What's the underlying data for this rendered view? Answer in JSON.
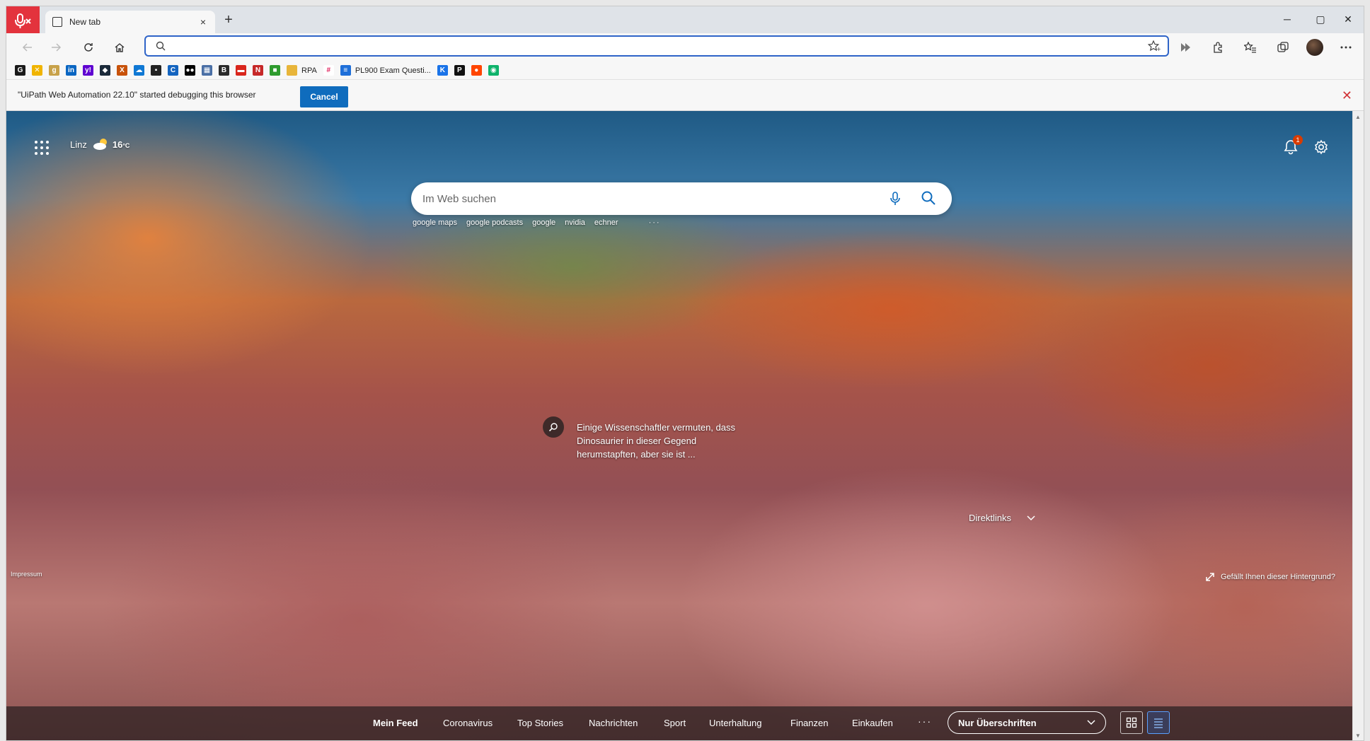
{
  "window": {
    "tab_title": "New tab",
    "tab_close": "×",
    "new_tab": "+",
    "controls": {
      "minimize": "─",
      "maximize": "▢",
      "close": "✕"
    }
  },
  "favorites": [
    {
      "icon": "g-doc-icon",
      "color": "#1a1a1a",
      "glyph": "G",
      "label": ""
    },
    {
      "icon": "x-icon",
      "color": "#f0b400",
      "glyph": "✕",
      "label": ""
    },
    {
      "icon": "g-icon",
      "color": "#c8a24a",
      "glyph": "g",
      "label": ""
    },
    {
      "icon": "linkedin-icon",
      "color": "#0a66c2",
      "glyph": "in",
      "label": ""
    },
    {
      "icon": "yahoo-icon",
      "color": "#5f01d1",
      "glyph": "y!",
      "label": ""
    },
    {
      "icon": "cube-icon",
      "color": "#1b2a3a",
      "glyph": "◆",
      "label": ""
    },
    {
      "icon": "xing-icon",
      "color": "#c8520a",
      "glyph": "X",
      "label": ""
    },
    {
      "icon": "onedrive-icon",
      "color": "#0f78d4",
      "glyph": "☁",
      "label": ""
    },
    {
      "icon": "dash-icon",
      "color": "#222222",
      "glyph": "▪",
      "label": ""
    },
    {
      "icon": "c-icon",
      "color": "#1565c0",
      "glyph": "C",
      "label": ""
    },
    {
      "icon": "medium-icon",
      "color": "#000000",
      "glyph": "●●",
      "label": ""
    },
    {
      "icon": "grid-app-icon",
      "color": "#4a6fa5",
      "glyph": "▦",
      "label": ""
    },
    {
      "icon": "b-icon",
      "color": "#2b2b2b",
      "glyph": "B",
      "label": ""
    },
    {
      "icon": "red-app-icon",
      "color": "#d9261c",
      "glyph": "▬",
      "label": ""
    },
    {
      "icon": "news-icon",
      "color": "#c62828",
      "glyph": "N",
      "label": ""
    },
    {
      "icon": "green-app-icon",
      "color": "#2e9b2e",
      "glyph": "■",
      "label": ""
    },
    {
      "icon": "folder-icon",
      "color": "#e8b53a",
      "glyph": "",
      "label": "RPA"
    },
    {
      "icon": "slack-icon",
      "color": "#ffffff",
      "glyph": "#",
      "label": ""
    },
    {
      "icon": "doc-list-icon",
      "color": "#1e6fd9",
      "glyph": "≡",
      "label": "PL900 Exam Questi..."
    },
    {
      "icon": "k-icon",
      "color": "#1a73e8",
      "glyph": "K",
      "label": ""
    },
    {
      "icon": "p-icon",
      "color": "#111111",
      "glyph": "P",
      "label": ""
    },
    {
      "icon": "reddit-icon",
      "color": "#ff4500",
      "glyph": "●",
      "label": ""
    },
    {
      "icon": "green-dot-icon",
      "color": "#0fb36b",
      "glyph": "◉",
      "label": ""
    }
  ],
  "infobar": {
    "message": "\"UiPath Web Automation 22.10\" started debugging this browser",
    "cancel": "Cancel",
    "close_icon": "✕"
  },
  "newtab": {
    "location": "Linz",
    "temperature": "16",
    "unit": "°C",
    "notification_count": "1",
    "search_placeholder": "Im Web suchen",
    "quick_links": [
      "google maps",
      "google podcasts",
      "google",
      "nvidia",
      "echner"
    ],
    "more": "···",
    "story": "Einige Wissenschaftler vermuten, dass Dinosaurier in dieser Gegend herumstapften, aber sie ist ...",
    "direktlinks": "Direktlinks",
    "impressum": "Impressum",
    "like_background": "Gefällt Ihnen dieser Hintergrund?"
  },
  "feed": {
    "tabs": [
      "Mein Feed",
      "Coronavirus",
      "Top Stories",
      "Nachrichten",
      "Sport",
      "Unterhaltung",
      "Finanzen",
      "Einkaufen"
    ],
    "more": "···",
    "view_select": "Nur Überschriften"
  },
  "colors": {
    "accent": "#0f6cbd",
    "mic_badge": "#e3333d",
    "address_border": "#2f64c8",
    "notification_badge": "#d83b01"
  }
}
